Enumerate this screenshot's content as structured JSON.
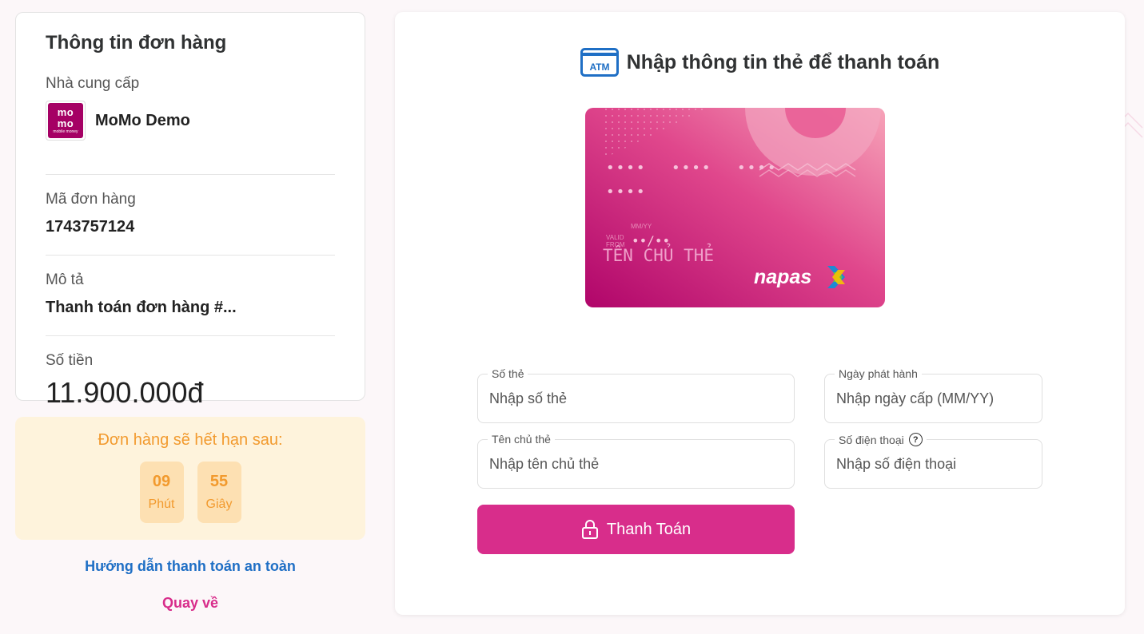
{
  "order": {
    "title": "Thông tin đơn hàng",
    "provider_label": "Nhà cung cấp",
    "provider_name": "MoMo Demo",
    "provider_logo_text": "mo",
    "provider_logo_sub": "mobile money",
    "order_id_label": "Mã đơn hàng",
    "order_id": "1743757124",
    "desc_label": "Mô tả",
    "desc": "Thanh toán đơn hàng #...",
    "amount_label": "Số tiền",
    "amount": "11.900.000đ"
  },
  "expire": {
    "text": "Đơn hàng sẽ hết hạn sau:",
    "minutes": "09",
    "minutes_label": "Phút",
    "seconds": "55",
    "seconds_label": "Giây"
  },
  "links": {
    "guide": "Hướng dẫn thanh toán an toàn",
    "back": "Quay về"
  },
  "payment": {
    "atm_text": "ATM",
    "title": "Nhập thông tin thẻ để thanh toán",
    "card": {
      "number_group": "••••",
      "valid_label_1": "VALID",
      "valid_label_2": "FROM",
      "mmyy_label": "MM/YY",
      "date_mask": "••/••",
      "holder": "TÊN CHỦ THẺ",
      "brand": "napas"
    },
    "fields": {
      "card_number_label": "Số thẻ",
      "card_number_placeholder": "Nhập số thẻ",
      "issue_date_label": "Ngày phát hành",
      "issue_date_placeholder": "Nhập ngày cấp (MM/YY)",
      "holder_label": "Tên chủ thẻ",
      "holder_placeholder": "Nhập tên chủ thẻ",
      "phone_label": "Số điện thoại",
      "phone_placeholder": "Nhập số điện thoại"
    },
    "submit": "Thanh Toán"
  },
  "colors": {
    "brand_pink": "#d82d8b",
    "link_blue": "#1f6fc5",
    "timer_orange": "#f29a2e",
    "timer_bg": "#fef3dc"
  },
  "icons": [
    "atm-icon",
    "lock-icon",
    "help-icon",
    "napas-logo-icon",
    "momo-logo"
  ]
}
